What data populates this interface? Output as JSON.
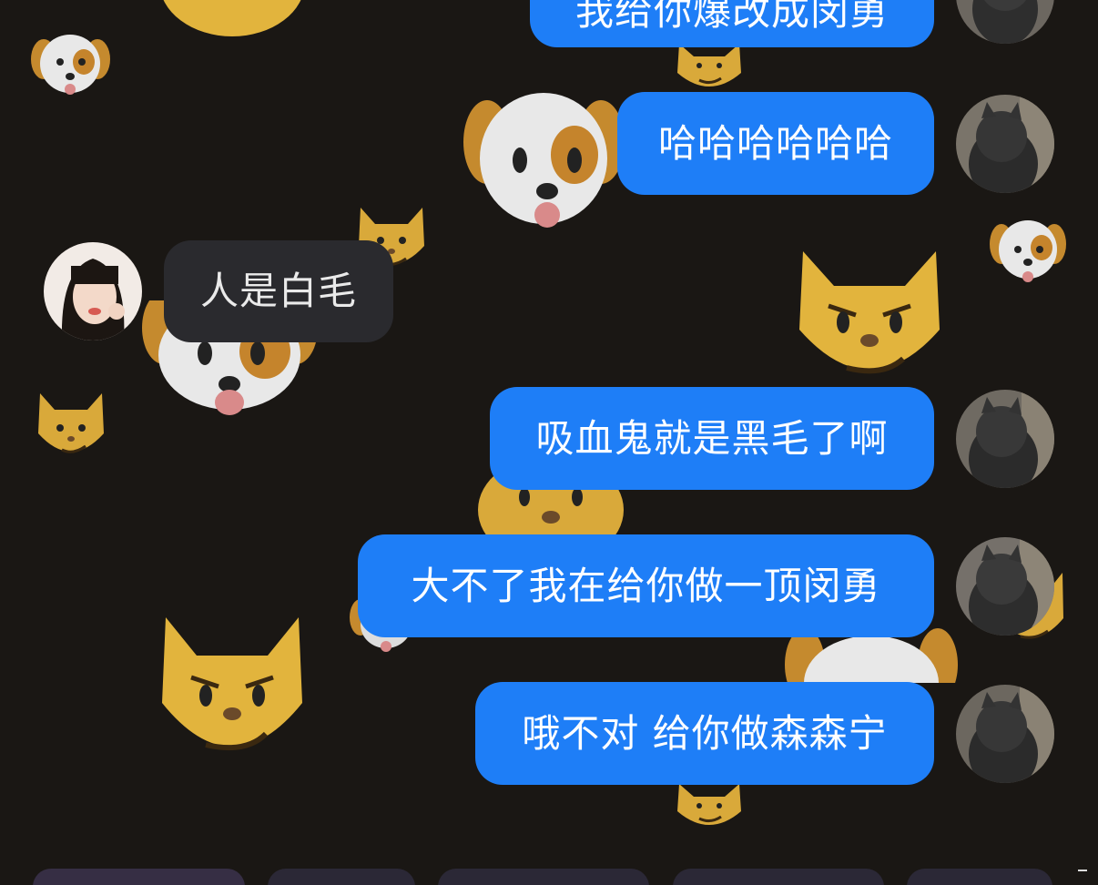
{
  "messages": [
    {
      "side": "sent",
      "text": "我给你爆改成闵勇"
    },
    {
      "side": "sent",
      "text": "哈哈哈哈哈哈"
    },
    {
      "side": "recv",
      "text": "人是白毛"
    },
    {
      "side": "sent",
      "text": "吸血鬼就是黑毛了啊"
    },
    {
      "side": "sent",
      "text": "大不了我在给你做一顶闵勇"
    },
    {
      "side": "sent",
      "text": "哦不对 给你做森森宁"
    }
  ],
  "avatars": {
    "self": "cat-photo-avatar",
    "other": "girl-photo-avatar"
  },
  "colors": {
    "background": "#1a1714",
    "sent_bubble": "#1e7ef7",
    "received_bubble": "#2a2a2e"
  },
  "stickers": [
    "dog-emoji-sticker",
    "cat-emoji-sticker"
  ]
}
